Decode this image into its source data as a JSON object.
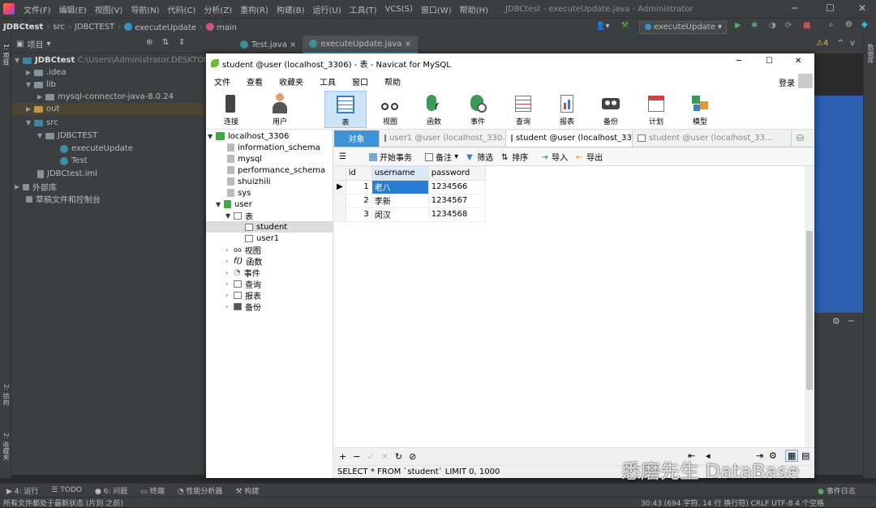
{
  "ide": {
    "menus": [
      "文件(F)",
      "编辑(E)",
      "视图(V)",
      "导航(N)",
      "代码(C)",
      "分析(Z)",
      "重构(R)",
      "构建(B)",
      "运行(U)",
      "工具(T)",
      "VCS(S)",
      "窗口(W)",
      "帮助(H)"
    ],
    "title": "JDBCtest - executeUpdate.java - Administrator",
    "breadcrumbs": [
      "JDBCtest",
      "src",
      "JDBCTEST",
      "executeUpdate",
      "main"
    ],
    "run_config": "executeUpdate",
    "project_label": "项目",
    "project_tree": {
      "root": "JDBCtest",
      "root_path": "C:\\Users\\Administrator.DESKTOP-N",
      "idea": ".idea",
      "lib": "lib",
      "connector": "mysql-connector-java-8.0.24",
      "out": "out",
      "src": "src",
      "package": "JDBCTEST",
      "file1": "executeUpdate",
      "file2": "Test",
      "iml": "JDBCtest.iml",
      "external": "外部库",
      "scratches": "草稿文件和控制台"
    },
    "editor_tabs": [
      "Test.java",
      "executeUpdate.java"
    ],
    "warn_count": "4",
    "status_tabs": [
      "4: 运行",
      "TODO",
      "6: 问题",
      "终端",
      "性能分析器",
      "构建"
    ],
    "event_log": "事件日志",
    "status_message": "所有文件都处于最新状态 (片刻 之前)",
    "status_right": "30:43 (694 字符, 14 行 换行符)   CRLF   UTF-8   4 个空格",
    "left_strip": [
      "1: 项目",
      "2: 结构",
      "2: 收藏夹"
    ],
    "right_strip": "数据库"
  },
  "navicat": {
    "title": "student @user (localhost_3306) - 表 - Navicat for MySQL",
    "menus": [
      "文件",
      "查看",
      "收藏夹",
      "工具",
      "窗口",
      "帮助"
    ],
    "login": "登录",
    "toolbar": [
      "连接",
      "用户",
      "表",
      "视图",
      "函数",
      "事件",
      "查询",
      "报表",
      "备份",
      "计划",
      "模型"
    ],
    "tree": {
      "connection": "localhost_3306",
      "dbs": [
        "information_schema",
        "mysql",
        "performance_schema",
        "shuizhili",
        "sys",
        "user"
      ],
      "tables_label": "表",
      "tables": [
        "student",
        "user1"
      ],
      "groups": [
        "视图",
        "函数",
        "事件",
        "查询",
        "报表",
        "备份"
      ]
    },
    "tabs": [
      "对象",
      "user1 @user (localhost_330...",
      "student @user (localhost_33...",
      "student @user (localhost_33..."
    ],
    "subtoolbar": [
      "开始事务",
      "备注",
      "筛选",
      "排序",
      "导入",
      "导出"
    ],
    "grid": {
      "columns": [
        "id",
        "username",
        "password"
      ],
      "rows": [
        [
          "1",
          "老八",
          "1234566"
        ],
        [
          "2",
          "李新",
          "1234567"
        ],
        [
          "3",
          "闵汉",
          "1234568"
        ]
      ]
    },
    "sql_status": "SELECT * FROM `student` LIMIT 0, 1000"
  },
  "watermark": "悉磨先生 DataBase",
  "colors": {
    "ide_bg": "#2b2b2b",
    "panel": "#3c3f41",
    "navicat_accent": "#3e92d6",
    "blue_block": "#2d5eb0"
  }
}
